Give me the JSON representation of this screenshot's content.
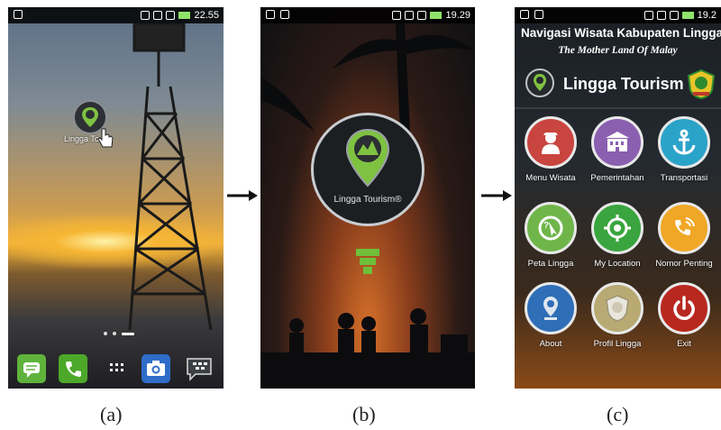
{
  "figure": {
    "captions": [
      "(a)",
      "(b)",
      "(c)"
    ]
  },
  "phone_a": {
    "status_time": "22.55",
    "desktop_icon_label": "Lingga To",
    "dock_icons": [
      "messages-icon",
      "phone-icon",
      "apps-icon",
      "camera-icon",
      "bbm-icon"
    ]
  },
  "phone_b": {
    "status_time": "19.29",
    "splash_label": "Lingga Tourism®"
  },
  "phone_c": {
    "status_time": "19.2",
    "title": "Navigasi Wisata Kabupaten Lingga",
    "subtitle": "The Mother Land Of Malay",
    "brand": "Lingga Tourism",
    "menu": [
      {
        "label": "Menu Wisata",
        "color": "#c9453f",
        "icon": "tourist-icon"
      },
      {
        "label": "Pemerintahan",
        "color": "#8b5fb0",
        "icon": "government-building-icon"
      },
      {
        "label": "Transportasi",
        "color": "#2aa3c9",
        "icon": "anchor-icon"
      },
      {
        "label": "Peta Lingga",
        "color": "#6fb54a",
        "icon": "map-icon"
      },
      {
        "label": "My Location",
        "color": "#3aa43e",
        "icon": "location-target-icon"
      },
      {
        "label": "Nomor Penting",
        "color": "#f0a726",
        "icon": "phone-call-icon"
      },
      {
        "label": "About",
        "color": "#2f6fb8",
        "icon": "about-logo-icon"
      },
      {
        "label": "Profil Lingga",
        "color": "#b8aa72",
        "icon": "emblem-icon"
      },
      {
        "label": "Exit",
        "color": "#b8281f",
        "icon": "power-icon"
      }
    ]
  }
}
